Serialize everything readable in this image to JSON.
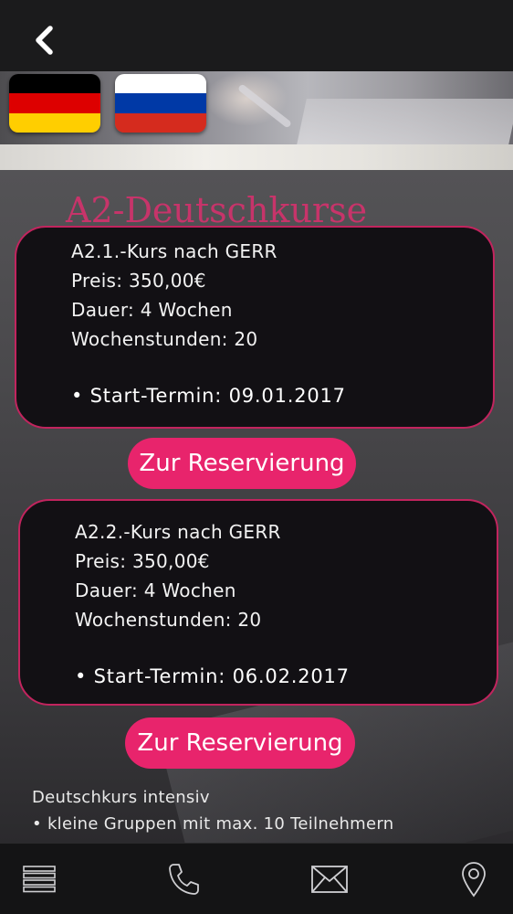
{
  "header": {
    "back_icon": "chevron-left-icon"
  },
  "languages": [
    {
      "name": "Deutsch",
      "colors": [
        "#000000",
        "#dd0000",
        "#ffce00"
      ]
    },
    {
      "name": "Russian",
      "colors": [
        "#ffffff",
        "#0039a6",
        "#d52b1e"
      ]
    }
  ],
  "page": {
    "title": "A2-Deutschkurse"
  },
  "courses": [
    {
      "name": "A2.1.-Kurs nach GERR",
      "price": "Preis: 350,00€",
      "duration": "Dauer: 4 Wochen",
      "hours": "Wochenstunden: 20",
      "start": "• Start-Termin: 09.01.2017",
      "button_label": "Zur Reservierung"
    },
    {
      "name": "A2.2.-Kurs nach GERR",
      "price": "Preis: 350,00€",
      "duration": "Dauer: 4 Wochen",
      "hours": "Wochenstunden: 20",
      "start": "• Start-Termin: 06.02.2017",
      "button_label": "Zur Reservierung"
    }
  ],
  "info": {
    "heading": "Deutschkurs intensiv",
    "bullet1": "• kleine Gruppen mit max. 10 Teilnehmern"
  },
  "bottom_nav": [
    {
      "icon": "menu-icon"
    },
    {
      "icon": "phone-icon"
    },
    {
      "icon": "mail-icon"
    },
    {
      "icon": "location-pin-icon"
    }
  ],
  "colors": {
    "accent": "#e8246c",
    "border": "#c2245e",
    "title": "#c7346a",
    "card_bg": "#121014"
  }
}
